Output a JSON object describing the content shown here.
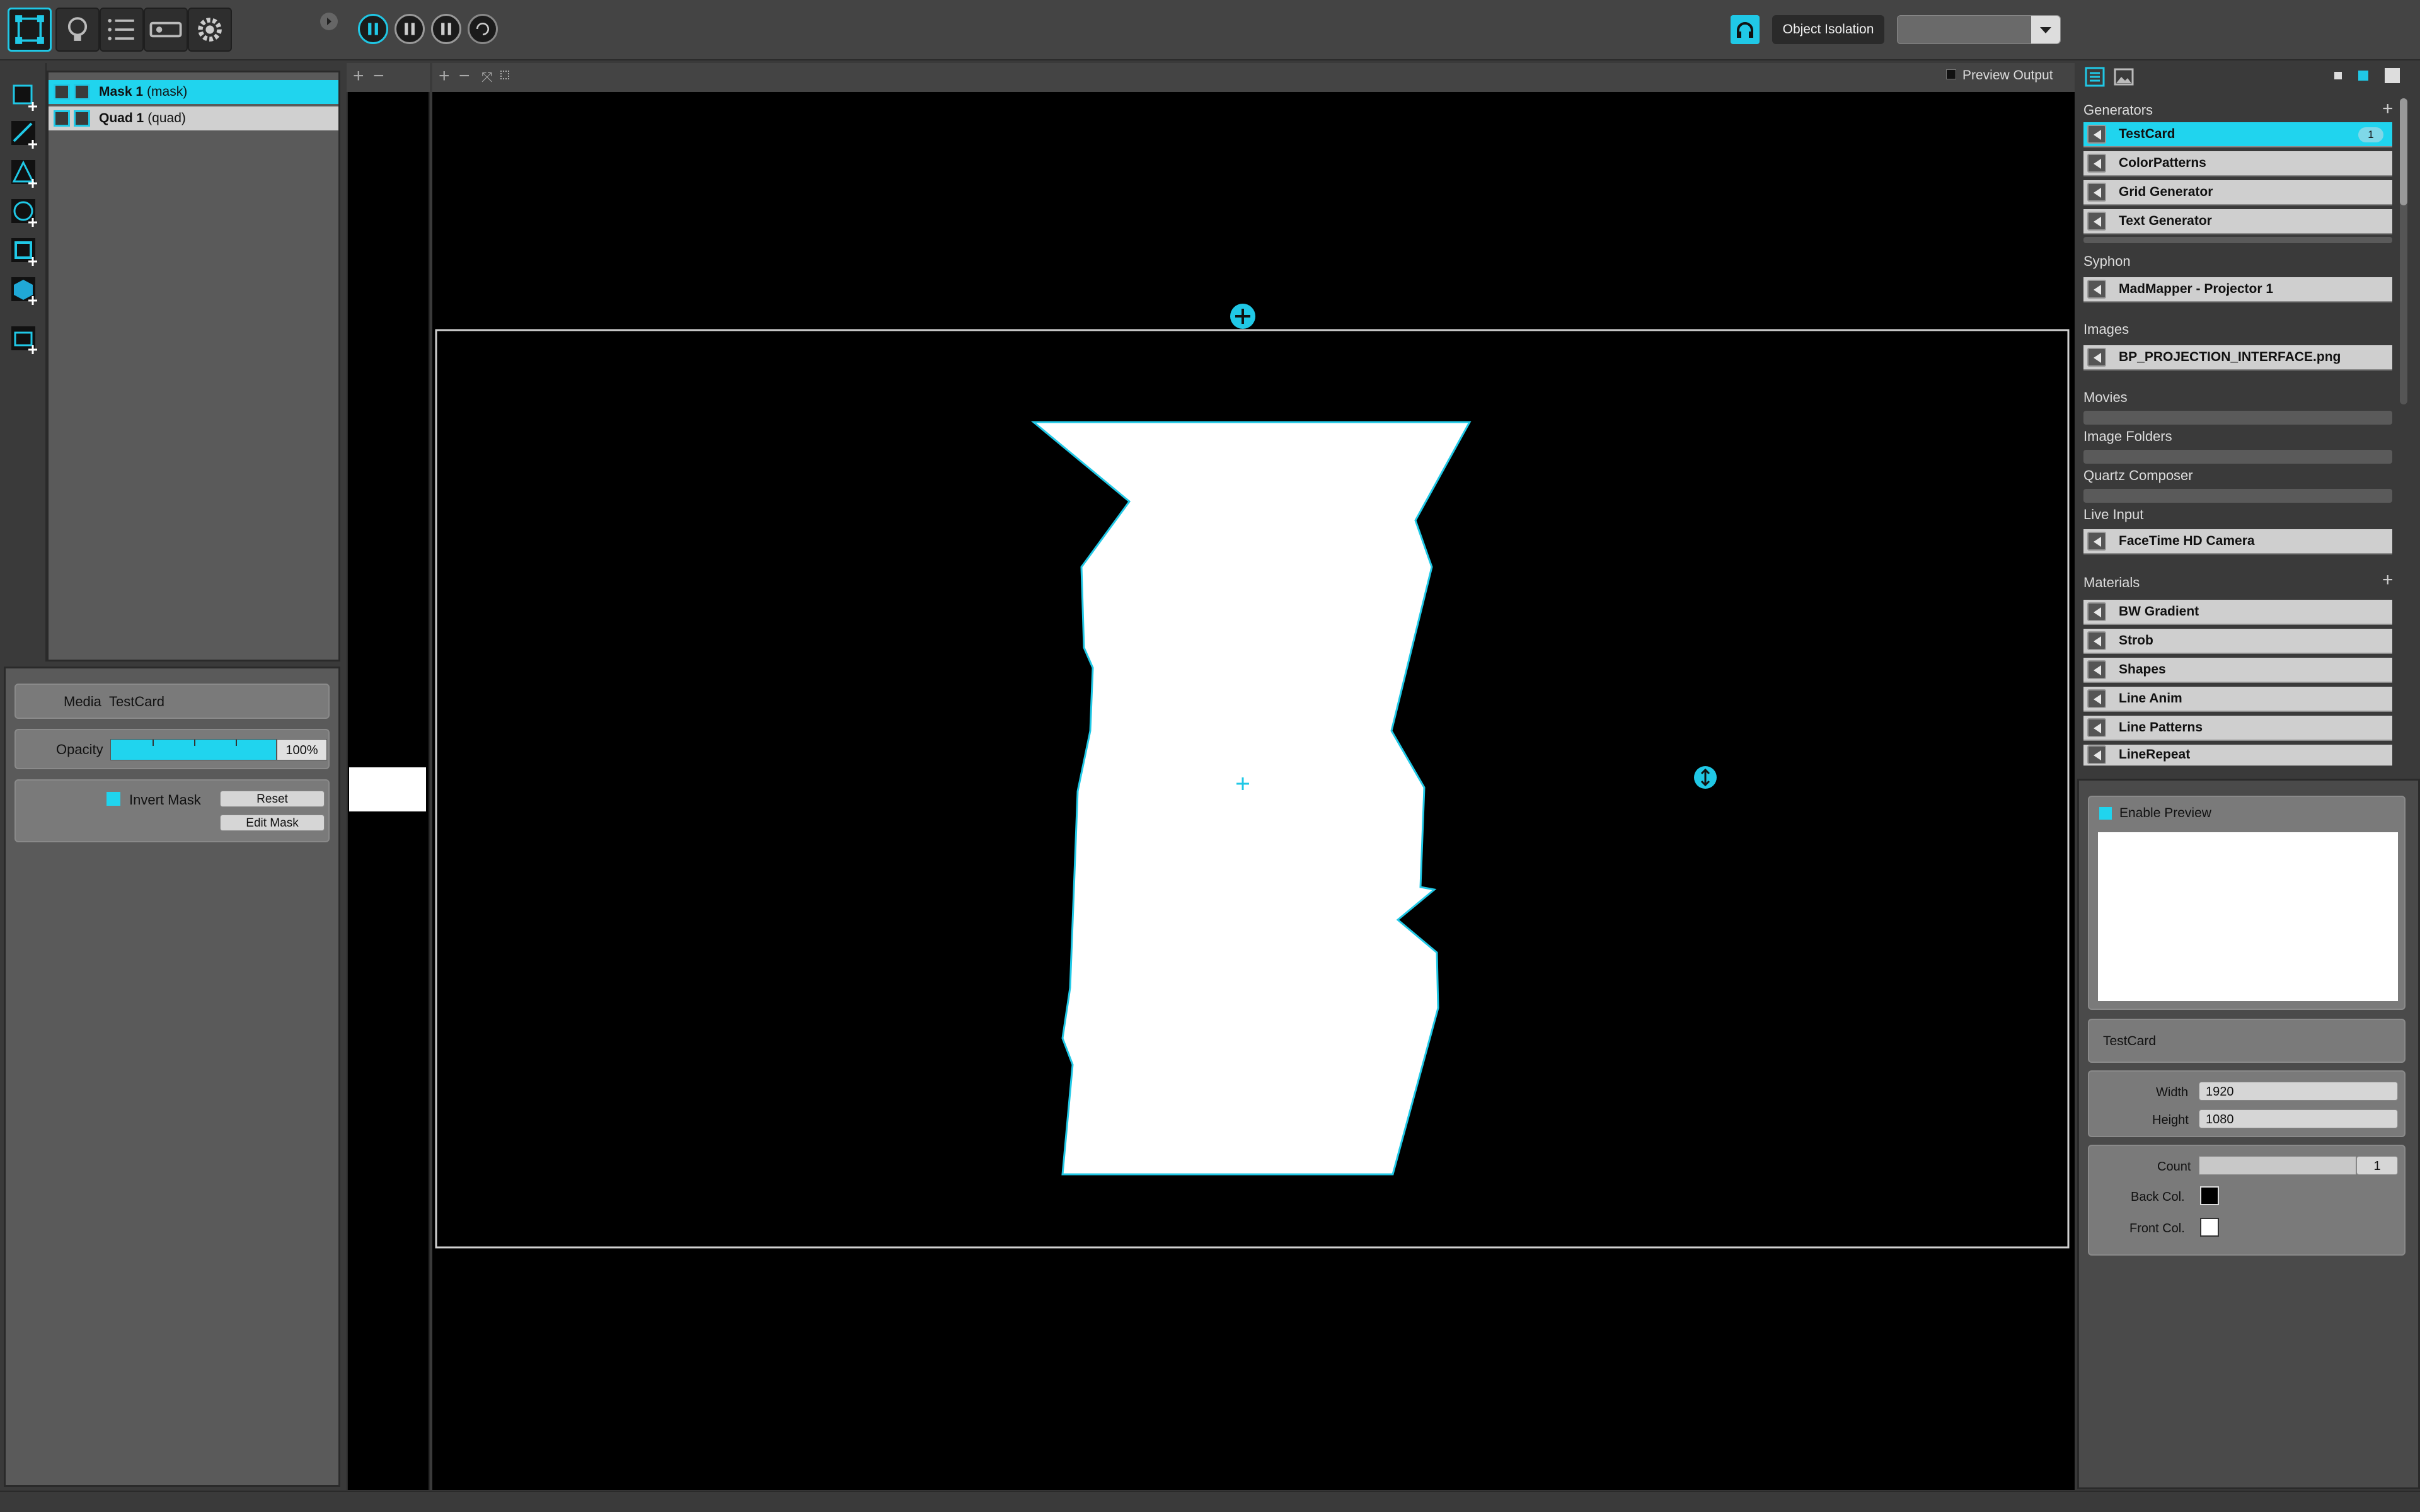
{
  "toolbar": {
    "object_isolation": "Object Isolation",
    "dropdown_value": ""
  },
  "objects": [
    {
      "name": "Mask 1",
      "type": "(mask)",
      "selected": true
    },
    {
      "name": "Quad 1",
      "type": "(quad)",
      "selected": false
    }
  ],
  "inspector": {
    "media_label": "Media",
    "media_value": "TestCard",
    "opacity_label": "Opacity",
    "opacity_value": "100%",
    "opacity_level": 1.0,
    "invert_mask_label": "Invert Mask",
    "reset_label": "Reset",
    "edit_mask_label": "Edit Mask"
  },
  "canvas": {
    "preview_output_label": "Preview Output"
  },
  "library": {
    "sections": {
      "generators": "Generators",
      "syphon": "Syphon",
      "images": "Images",
      "movies": "Movies",
      "image_folders": "Image Folders",
      "quartz_composer": "Quartz Composer",
      "live_input": "Live Input",
      "materials": "Materials"
    },
    "generators": [
      {
        "name": "TestCard",
        "badge": "1"
      },
      {
        "name": "ColorPatterns"
      },
      {
        "name": "Grid Generator"
      },
      {
        "name": "Text Generator"
      }
    ],
    "syphon": [
      "MadMapper - Projector 1"
    ],
    "images": [
      "BP_PROJECTION_INTERFACE.png"
    ],
    "live_input": [
      "FaceTime HD Camera"
    ],
    "materials": [
      "BW Gradient",
      "Strob",
      "Shapes",
      "Line Anim",
      "Line Patterns",
      "LineRepeat"
    ]
  },
  "properties": {
    "enable_preview_label": "Enable Preview",
    "media_name": "TestCard",
    "width_label": "Width",
    "width_value": "1920",
    "height_label": "Height",
    "height_value": "1080",
    "count_label": "Count",
    "count_value": "1",
    "back_col_label": "Back Col.",
    "front_col_label": "Front Col."
  },
  "colors": {
    "accent": "#20c8e6",
    "selection": "#20d4ee",
    "back_col": "#000000",
    "front_col": "#ffffff"
  }
}
